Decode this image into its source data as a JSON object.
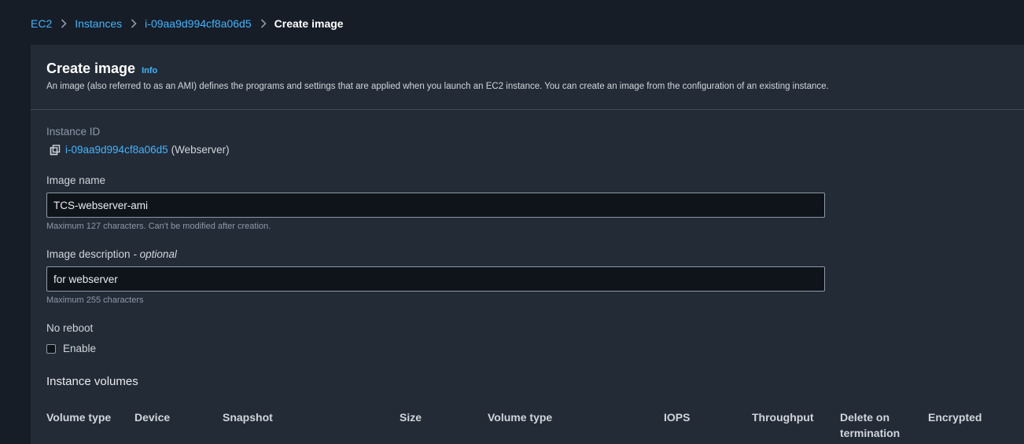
{
  "breadcrumb": {
    "items": [
      "EC2",
      "Instances",
      "i-09aa9d994cf8a06d5"
    ],
    "current": "Create image"
  },
  "header": {
    "title": "Create image",
    "info": "Info",
    "description": "An image (also referred to as an AMI) defines the programs and settings that are applied when you launch an EC2 instance. You can create an image from the configuration of an existing instance."
  },
  "instance": {
    "label": "Instance ID",
    "id": "i-09aa9d994cf8a06d5",
    "name": "(Webserver)"
  },
  "image_name": {
    "label": "Image name",
    "value": "TCS-webserver-ami",
    "hint": "Maximum 127 characters. Can't be modified after creation."
  },
  "image_description": {
    "label": "Image description",
    "optional": "- optional",
    "value": "for webserver",
    "hint": "Maximum 255 characters"
  },
  "no_reboot": {
    "label": "No reboot",
    "checkbox_label": "Enable",
    "checked": false
  },
  "volumes": {
    "title": "Instance volumes",
    "columns": [
      "Volume type",
      "Device",
      "Snapshot",
      "Size",
      "Volume type",
      "IOPS",
      "Throughput",
      "Delete on termination",
      "Encrypted"
    ]
  },
  "colors": {
    "page_bg": "#161d26",
    "panel_bg": "#232b36",
    "link": "#42b4ff",
    "input_bg": "#0f141a"
  }
}
